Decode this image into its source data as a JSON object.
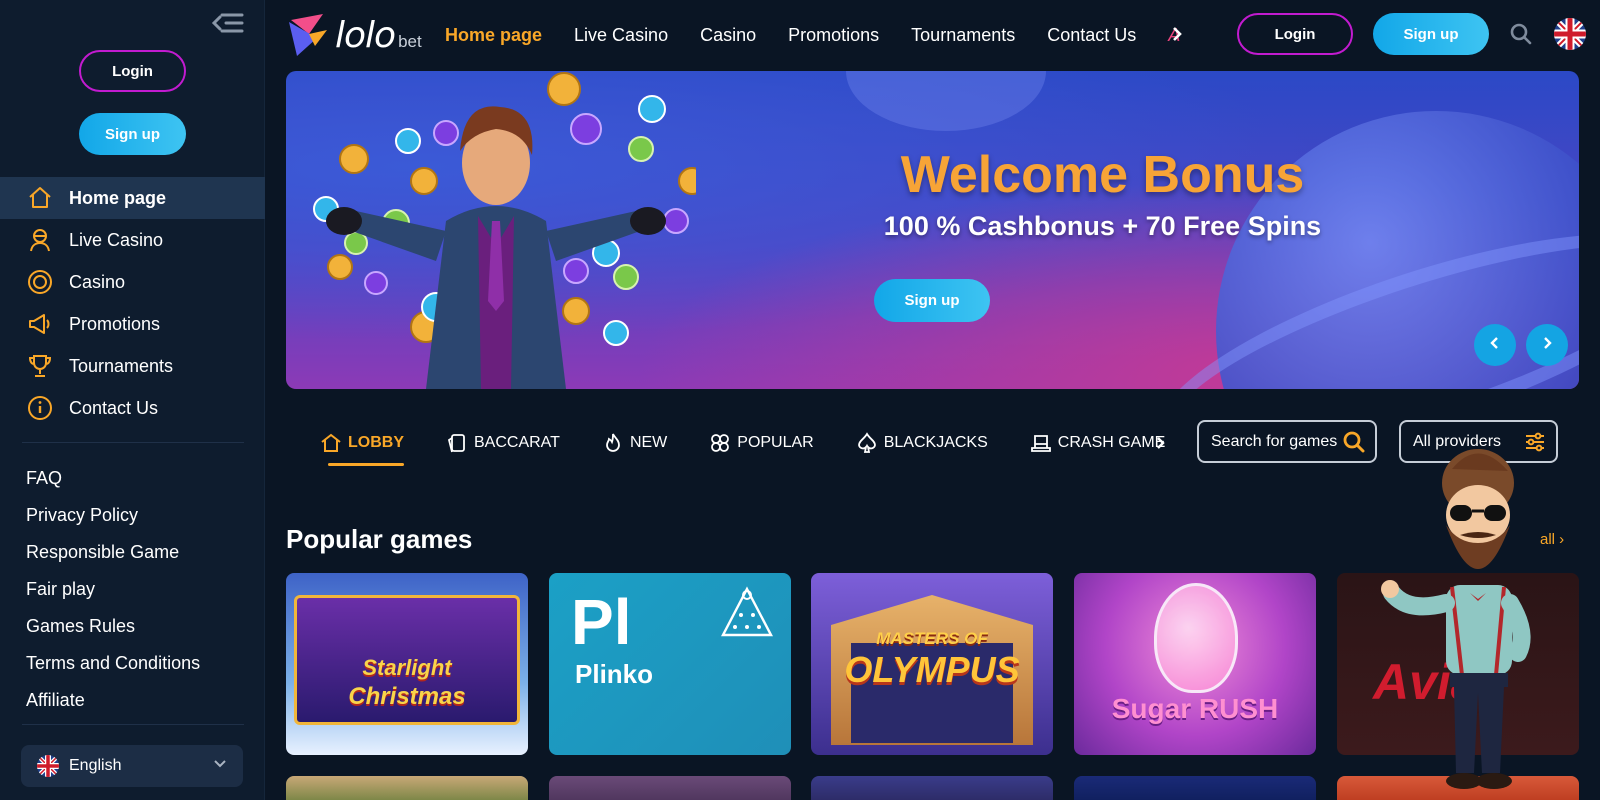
{
  "sidebar": {
    "login_label": "Login",
    "signup_label": "Sign up",
    "nav": [
      {
        "label": "Home page",
        "icon": "home-icon",
        "active": true
      },
      {
        "label": "Live Casino",
        "icon": "dealer-icon"
      },
      {
        "label": "Casino",
        "icon": "chip-icon"
      },
      {
        "label": "Promotions",
        "icon": "megaphone-icon"
      },
      {
        "label": "Tournaments",
        "icon": "trophy-icon"
      },
      {
        "label": "Contact Us",
        "icon": "info-icon"
      }
    ],
    "links": [
      "FAQ",
      "Privacy Policy",
      "Responsible Game",
      "Fair play",
      "Games Rules",
      "Terms and Conditions",
      "Affiliate"
    ],
    "language": "English"
  },
  "header": {
    "logo_main": "lolo",
    "logo_sub": "bet",
    "nav": [
      "Home page",
      "Live Casino",
      "Casino",
      "Promotions",
      "Tournaments",
      "Contact Us"
    ],
    "nav_more": "A",
    "login_label": "Login",
    "signup_label": "Sign up"
  },
  "banner": {
    "title": "Welcome Bonus",
    "subtitle": "100 % Cashbonus + 70 Free Spins",
    "cta_label": "Sign up"
  },
  "categories": [
    {
      "label": "LOBBY",
      "icon": "home-icon",
      "active": true
    },
    {
      "label": "BACCARAT",
      "icon": "cards-icon"
    },
    {
      "label": "NEW",
      "icon": "flame-icon"
    },
    {
      "label": "POPULAR",
      "icon": "clover-icon"
    },
    {
      "label": "BLACKJACKS",
      "icon": "spade-icon"
    },
    {
      "label": "CRASH GAME",
      "icon": "top-hat-icon"
    }
  ],
  "search": {
    "label": "Search for games"
  },
  "providers": {
    "label": "All providers"
  },
  "popular": {
    "title": "Popular games",
    "see_all": "all",
    "games": [
      {
        "line1": "Starlight",
        "line2": "Christmas"
      },
      {
        "line1": "Pl",
        "line2": "Plinko"
      },
      {
        "line1": "MASTERS OF",
        "line2": "OLYMPUS"
      },
      {
        "line1": "Sugar",
        "line2": "RUSH"
      },
      {
        "line1": "Avia",
        "line2": ""
      }
    ]
  },
  "colors": {
    "accent": "#f9a728",
    "primary_blue": "#14a4e3",
    "outline_magenta": "#c21bd0",
    "sidebar_bg": "#0e1c2e",
    "page_bg": "#0a1524"
  }
}
